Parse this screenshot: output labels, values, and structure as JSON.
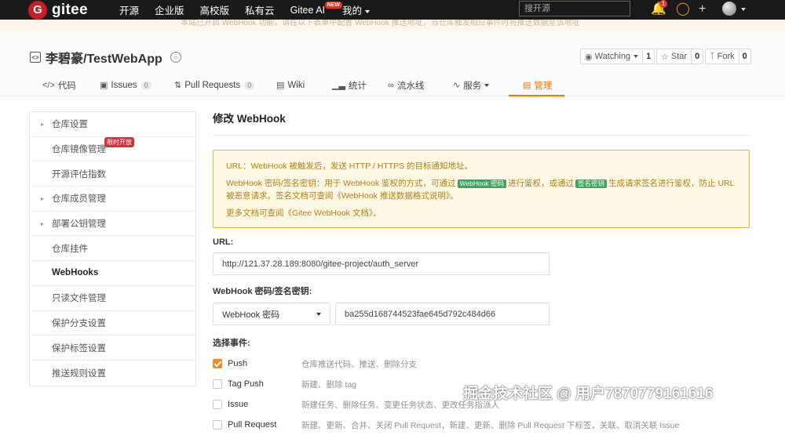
{
  "nav": {
    "logo_mark": "G",
    "logo_text": "gitee",
    "links": [
      "开源",
      "企业版",
      "高校版",
      "私有云",
      "Gitee AI",
      "我的"
    ],
    "new_badge": "NEW",
    "search_placeholder": "搜开源",
    "notification_count": "1"
  },
  "banner_text": "本站已开启 WebHook 功能，请在以下表单中配置 WebHook 推送地址，当仓库触发相应事件时将推送数据至该地址",
  "repo": {
    "name": "李碧豪/TestWebApp",
    "watching_label": "Watching",
    "watching_count": "1",
    "star_label": "Star",
    "star_count": "0",
    "fork_label": "Fork",
    "fork_count": "0"
  },
  "tabs": [
    {
      "label": "代码"
    },
    {
      "label": "Issues",
      "count": "0"
    },
    {
      "label": "Pull Requests",
      "count": "0"
    },
    {
      "label": "Wiki"
    },
    {
      "label": "统计"
    },
    {
      "label": "流水线"
    },
    {
      "label": "服务"
    },
    {
      "label": "管理"
    }
  ],
  "sidebar": {
    "items": [
      {
        "label": "仓库设置"
      },
      {
        "label": "仓库镜像管理",
        "badge": "限时开放"
      },
      {
        "label": "开源评估指数"
      },
      {
        "label": "仓库成员管理"
      },
      {
        "label": "部署公钥管理"
      },
      {
        "label": "仓库挂件"
      },
      {
        "label": "WebHooks"
      },
      {
        "label": "只读文件管理"
      },
      {
        "label": "保护分支设置"
      },
      {
        "label": "保护标签设置"
      },
      {
        "label": "推送规则设置"
      }
    ]
  },
  "main": {
    "title": "修改 WebHook",
    "notice": {
      "line1": "URL：WebHook 被触发后，发送 HTTP / HTTPS 的目标通知地址。",
      "line2_a": "WebHook 密码/签名密钥：用于 WebHook 鉴权的方式，可通过",
      "tag1": "WebHook 密码",
      "line2_b": "进行鉴权，或通过",
      "tag2": "签名密钥",
      "line2_c": "生成请求签名进行鉴权，防止 URL 被恶意请求。签名文档可查阅",
      "link1": "《WebHook 推送数据格式说明》",
      "line2_d": "。",
      "line3_a": "更多文档可查阅",
      "link2": "《Gitee WebHook 文档》",
      "line3_b": "。"
    },
    "url_label": "URL:",
    "url_value": "http://121.37.28.189:8080/gitee-project/auth_server",
    "secret_label": "WebHook 密码/签名密钥:",
    "secret_type": "WebHook 密码",
    "secret_value": "ba255d168744523fae645d792c484d66",
    "events_label": "选择事件:",
    "events": [
      {
        "name": "Push",
        "desc": "仓库推送代码、推送、删除分支",
        "checked": true
      },
      {
        "name": "Tag Push",
        "desc": "新建、删除 tag",
        "checked": false
      },
      {
        "name": "Issue",
        "desc": "新建任务、删除任务、变更任务状态、更改任务指派人",
        "checked": false
      },
      {
        "name": "Pull Request",
        "desc": "新建、更新、合并、关闭 Pull Request，新建、更新、删除 Pull Request 下标签，关联、取消关联 Issue",
        "checked": false
      }
    ]
  },
  "watermark": "掘金技术社区 @ 用户7870779161616",
  "colors": {
    "accent": "#fe7300",
    "notice_border": "#e0b43b",
    "tag_green": "#3ca55c",
    "brand_red": "#c71d23"
  }
}
